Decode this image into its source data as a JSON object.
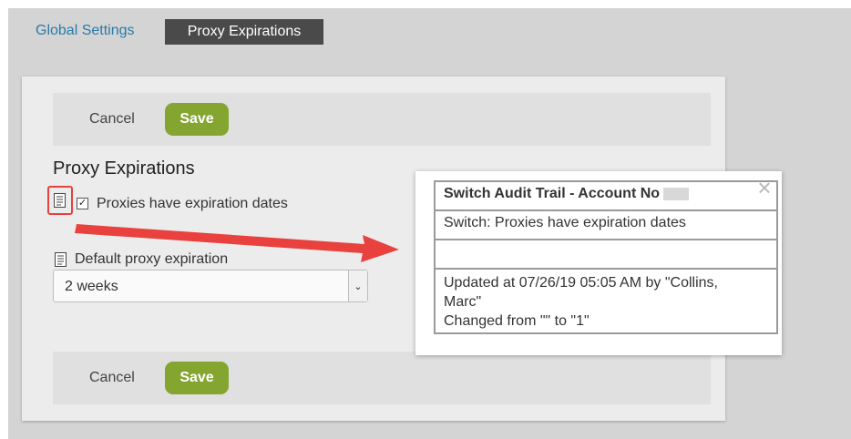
{
  "tabs": {
    "global_settings": "Global Settings",
    "proxy_expirations": "Proxy Expirations"
  },
  "toolbar": {
    "cancel_label": "Cancel",
    "save_label": "Save"
  },
  "section": {
    "title": "Proxy Expirations",
    "checkbox_label": "Proxies have expiration dates",
    "checkbox_checked": true,
    "default_expiration_label": "Default proxy expiration",
    "default_expiration_value": "2 weeks"
  },
  "audit_popup": {
    "title": "Switch Audit Trail - Account No",
    "switch_text": "Switch: Proxies have expiration dates",
    "empty_row": "",
    "updated_line1": "Updated at 07/26/19 05:05 AM by \"Collins,",
    "updated_line2": "Marc\"",
    "changed_line": "Changed from \"\" to \"1\""
  },
  "colors": {
    "accent_save": "#85a531",
    "link": "#2a7aa8",
    "highlight": "#e8413e"
  },
  "icons": [
    "document-icon",
    "checkbox-icon",
    "chevron-down-icon",
    "close-icon",
    "arrow-annotation"
  ]
}
